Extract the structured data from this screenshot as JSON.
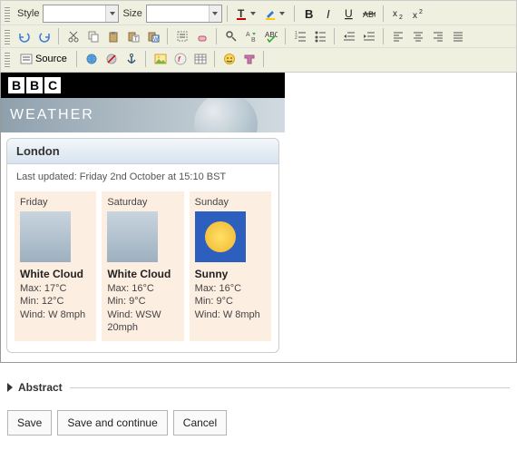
{
  "toolbar": {
    "style_label": "Style",
    "size_label": "Size",
    "source_label": "Source"
  },
  "bbc": {
    "b1": "B",
    "b2": "B",
    "b3": "C"
  },
  "banner": {
    "title": "WEATHER"
  },
  "city": {
    "name": "London",
    "updated": "Last updated: Friday 2nd October at 15:10 BST"
  },
  "days": [
    {
      "name": "Friday",
      "cond": "White Cloud",
      "max": "Max: 17°C",
      "min": "Min: 12°C",
      "wind": "Wind: W 8mph",
      "thumb": "cloud"
    },
    {
      "name": "Saturday",
      "cond": "White Cloud",
      "max": "Max: 16°C",
      "min": "Min: 9°C",
      "wind": "Wind: WSW 20mph",
      "thumb": "cloud"
    },
    {
      "name": "Sunday",
      "cond": "Sunny",
      "max": "Max: 16°C",
      "min": "Min: 9°C",
      "wind": "Wind: W 8mph",
      "thumb": "sun"
    }
  ],
  "section": {
    "abstract": "Abstract"
  },
  "buttons": {
    "save": "Save",
    "save_continue": "Save and continue",
    "cancel": "Cancel"
  }
}
